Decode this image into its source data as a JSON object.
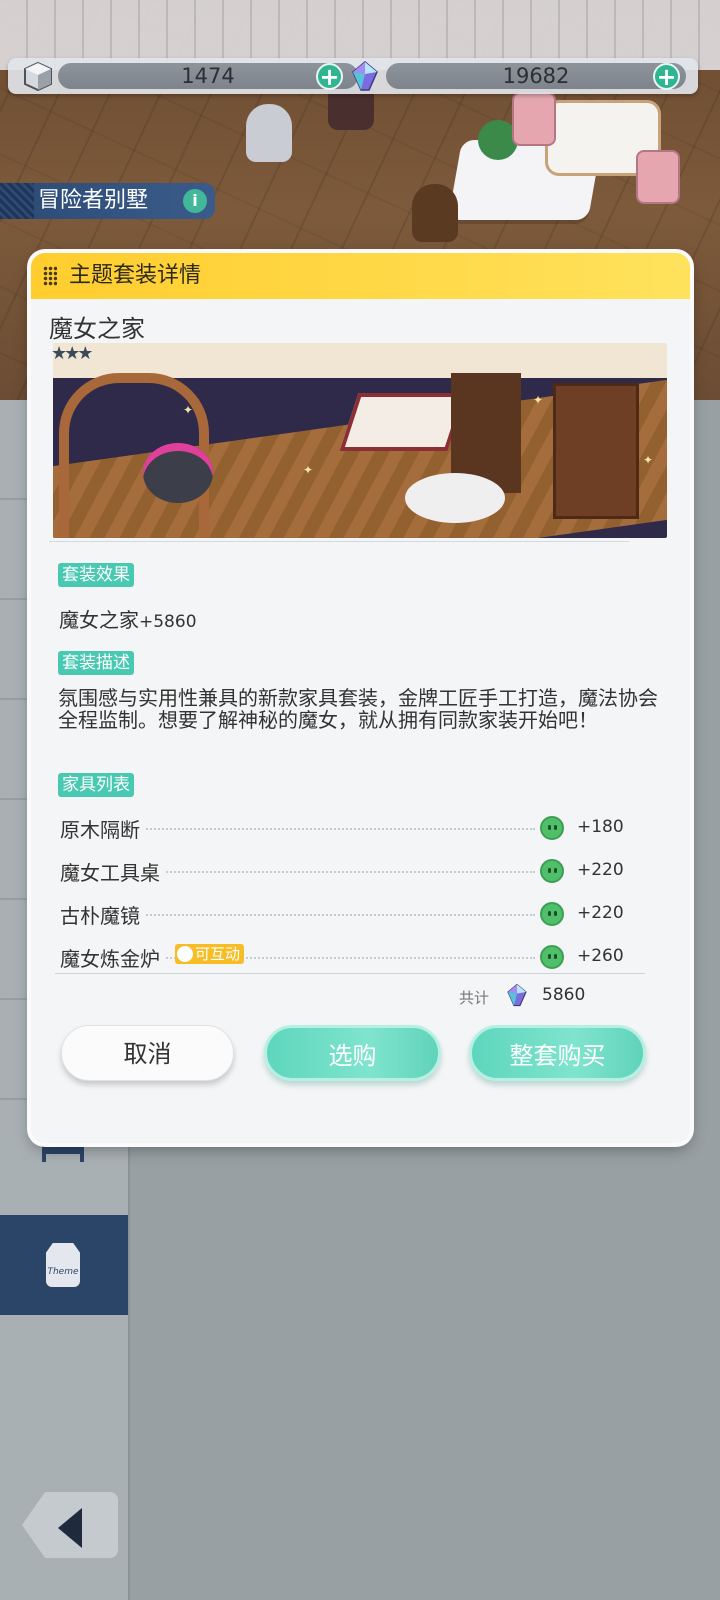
{
  "top_bar": {
    "resource_1_value": "1474",
    "resource_2_value": "19682",
    "resource_1_icon": "stone-cube-icon",
    "resource_2_icon": "crystal-icon",
    "plus_icon": "plus-icon"
  },
  "location": {
    "name": "冒险者别墅",
    "info_label": "i"
  },
  "modal": {
    "title": "主题套装详情",
    "set_name": "魔女之家",
    "rarity_stars": "★★★",
    "effect_tag": "套装效果",
    "effect_name": "魔女之家",
    "effect_value": "+5860",
    "description_tag": "套装描述",
    "description": "氛围感与实用性兼具的新款家具套装，金牌工匠手工打造，魔法协会全程监制。想要了解神秘的魔女，就从拥有同款家装开始吧！",
    "list_tag": "家具列表",
    "furniture": [
      {
        "name": "原木隔断",
        "value": "+180"
      },
      {
        "name": "魔女工具桌",
        "value": "+220"
      },
      {
        "name": "古朴魔镜",
        "value": "+220"
      },
      {
        "name": "魔女炼金炉",
        "value": "+260",
        "badge": "可互动"
      }
    ],
    "total_label": "共计",
    "total_value": "5860",
    "buttons": {
      "cancel": "取消",
      "select_buy": "选购",
      "buy_all": "整套购买"
    }
  },
  "sidebar": {
    "theme_label": "Theme"
  },
  "colors": {
    "header_yellow": "#ffcd2e",
    "teal_accent": "#49c9b1",
    "nav_blue": "#2b4568"
  }
}
